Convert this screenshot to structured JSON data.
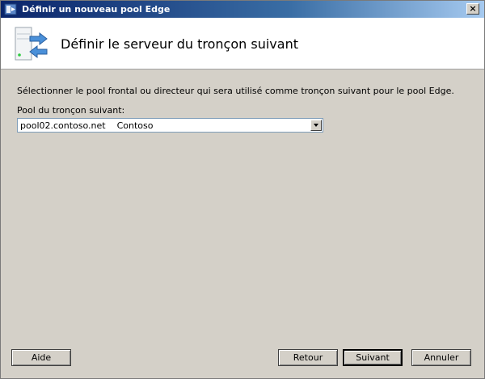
{
  "window": {
    "title": "Définir un nouveau pool Edge",
    "close_label": "×"
  },
  "header": {
    "title": "Définir le serveur du tronçon suivant"
  },
  "main": {
    "instruction": "Sélectionner le pool frontal ou directeur qui sera utilisé comme tronçon suivant pour le pool Edge.",
    "pool_label": "Pool du tronçon suivant:",
    "pool_value": "pool02.contoso.net    Contoso"
  },
  "footer": {
    "help_label": "Aide",
    "back_label": "Retour",
    "next_label": "Suivant",
    "cancel_label": "Annuler"
  },
  "icons": {
    "app": "server-wizard-icon",
    "header": "server-arrows-icon",
    "close": "close-icon",
    "dropdown": "chevron-down-icon"
  }
}
